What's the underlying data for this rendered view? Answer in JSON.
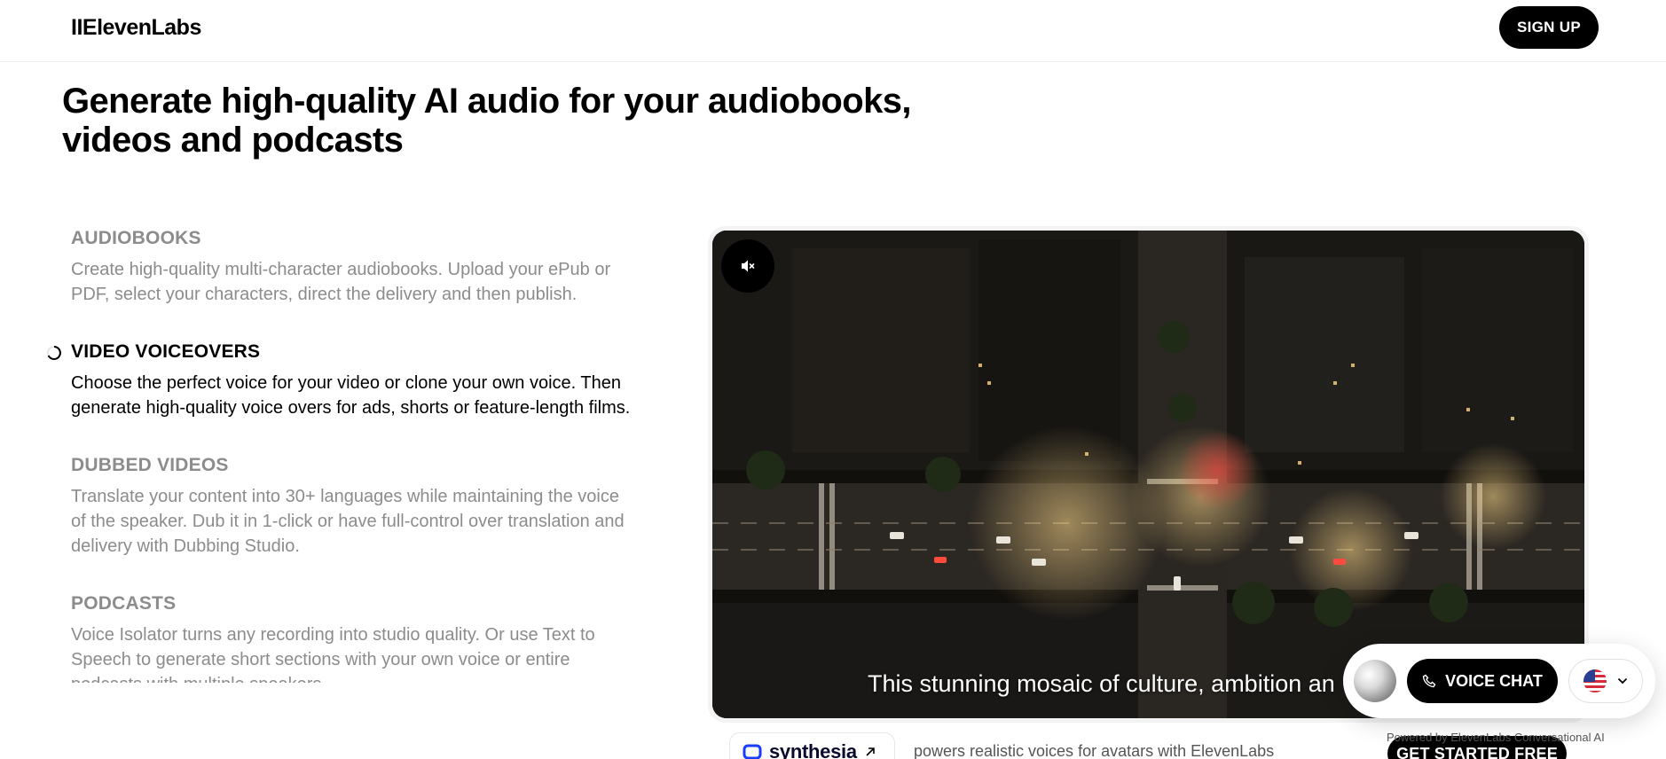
{
  "header": {
    "logo": "IIElevenLabs",
    "signup_label": "SIGN UP"
  },
  "hero": {
    "title_line1": "Generate high-quality AI audio for your audiobooks,",
    "title_line2": "videos and podcasts"
  },
  "features": [
    {
      "title": "AUDIOBOOKS",
      "description": "Create high-quality multi-character audiobooks. Upload your ePub or PDF, select your characters, direct the delivery and then publish.",
      "active": false
    },
    {
      "title": "VIDEO VOICEOVERS",
      "description": "Choose the perfect voice for your video or clone your own voice. Then generate high-quality voice overs for ads, shorts or feature-length films.",
      "active": true
    },
    {
      "title": "DUBBED VIDEOS",
      "description": "Translate your content into 30+ languages while maintaining the voice of the speaker. Dub it in 1-click or have full-control over translation and delivery with Dubbing Studio.",
      "active": false
    },
    {
      "title": "PODCASTS",
      "description": "Voice Isolator turns any recording into studio quality. Or use Text to Speech to generate short sections with your own voice or entire podcasts with multiple speakers.",
      "active": false
    }
  ],
  "video": {
    "caption": "This stunning mosaic of culture, ambition an",
    "muted": true
  },
  "partner": {
    "name": "synthesia",
    "text": "powers realistic voices for avatars with ElevenLabs"
  },
  "widget": {
    "voice_chat_label": "VOICE CHAT",
    "powered_by": "Powered by ElevenLabs Conversational AI",
    "get_started_label": "GET STARTED FREE"
  },
  "colors": {
    "accent": "#000000",
    "muted_text": "#8c8c8c",
    "partner_blue": "#1a3cff"
  }
}
